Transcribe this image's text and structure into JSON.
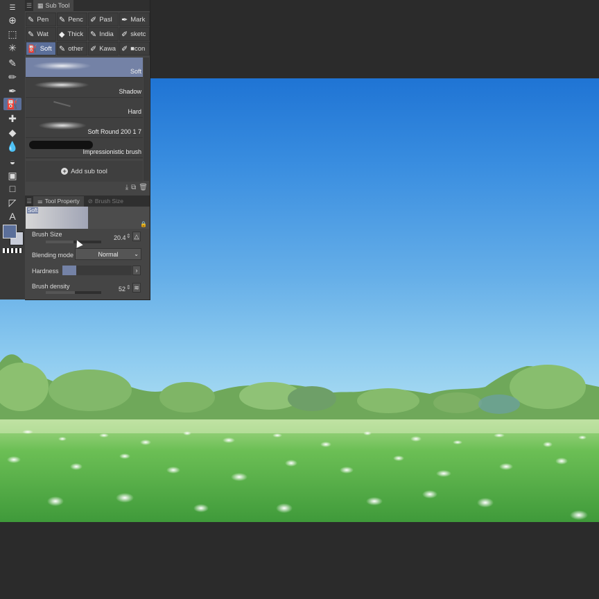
{
  "subtool_panel": {
    "tab_label": "Sub Tool",
    "groups": [
      {
        "label": "Pen",
        "icon": "pen-icon"
      },
      {
        "label": "Penc",
        "icon": "pencil-icon"
      },
      {
        "label": "Pasl",
        "icon": "pastel-icon"
      },
      {
        "label": "Mark",
        "icon": "marker-icon"
      },
      {
        "label": "Wat",
        "icon": "watercolor-icon"
      },
      {
        "label": "Thick",
        "icon": "thick-paint-icon"
      },
      {
        "label": "India",
        "icon": "india-ink-icon"
      },
      {
        "label": "sketc",
        "icon": "sketch-icon"
      },
      {
        "label": "Soft",
        "icon": "airbrush-icon"
      },
      {
        "label": "other",
        "icon": "other-brush-icon"
      },
      {
        "label": "Kawa",
        "icon": "kawa-brush-icon"
      },
      {
        "label": "■con",
        "icon": "con-brush-icon"
      }
    ],
    "brushes": [
      {
        "label": "Soft",
        "selected": true
      },
      {
        "label": "Shadow",
        "selected": false
      },
      {
        "label": "Hard",
        "selected": false
      },
      {
        "label": "Soft Round 200 1 7",
        "selected": false
      },
      {
        "label": "Impressionistic brush",
        "selected": false
      }
    ],
    "add_sub_tool": "Add sub tool"
  },
  "tool_property": {
    "tab_label": "Tool Property",
    "inactive_tab_label": "Brush Size",
    "preview_label": "Soft",
    "brush_size_label": "Brush Size",
    "brush_size_value": "20.4",
    "brush_size_fraction": 0.5,
    "blending_mode_label": "Blending mode",
    "blending_mode_value": "Normal",
    "hardness_label": "Hardness",
    "hardness_fraction": 0.2,
    "brush_density_label": "Brush density",
    "brush_density_value": "52",
    "brush_density_fraction": 0.52
  },
  "colors": {
    "main": "#5b6f9a",
    "sub": "#c8ccd8",
    "accent": "#5b6f9a"
  }
}
